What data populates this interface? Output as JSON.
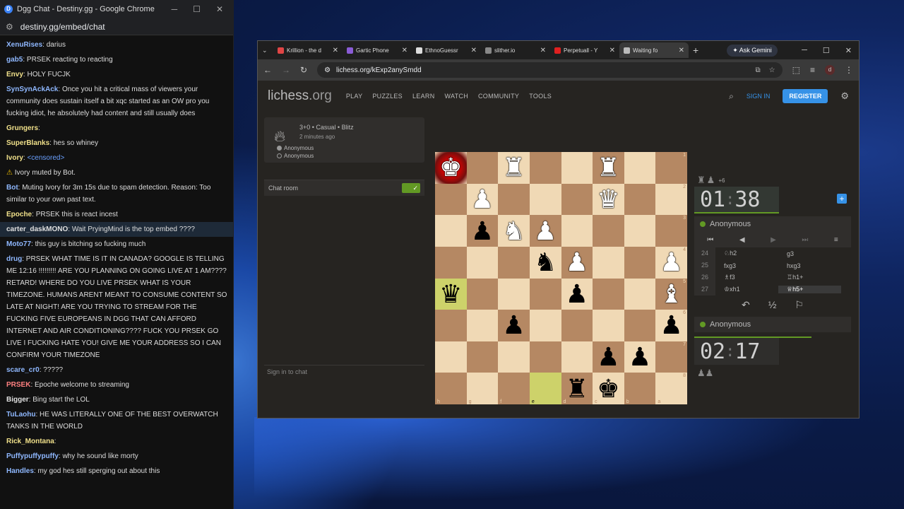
{
  "chat_window": {
    "title": "Dgg Chat - Destiny.gg - Google Chrome",
    "app_letter": "D",
    "url": "destiny.gg/embed/chat"
  },
  "chat": {
    "messages": [
      {
        "user": "XenuRises",
        "sep": ": ",
        "text": "darius",
        "user_color": "#8fb8ff"
      },
      {
        "user": "gab5",
        "sep": ": ",
        "text": "PRSEK reacting to reacting",
        "user_color": "#8fb8ff"
      },
      {
        "user": "Envy",
        "sep": ": ",
        "text": "HOLY FUCJK",
        "user_color": "#f0e08a"
      },
      {
        "user": "SynSynAckAck",
        "sep": ": ",
        "text": "Once you hit a critical mass of viewers your community does sustain itself a bit      xqc started as an OW pro you fucking idiot, he absolutely had content and still usually does",
        "user_color": "#8fb8ff"
      },
      {
        "user": "Grungers",
        "sep": ": ",
        "text": "",
        "user_color": "#f0e08a"
      },
      {
        "user": "SuperBlanks",
        "sep": ": ",
        "text": "hes so whiney",
        "user_color": "#f0e08a"
      },
      {
        "user": "Ivory",
        "sep": ": ",
        "text": "<censored>",
        "user_color": "#f0e08a"
      },
      {
        "user": "",
        "sep": "",
        "text": "Ivory muted by Bot.",
        "user_color": "#f0e08a"
      },
      {
        "user": "Bot",
        "sep": ": ",
        "text": "Muting Ivory for 3m 15s due to spam detection. Reason: Too similar to your own past text.",
        "user_color": "#8fb8ff"
      },
      {
        "user": "Epoche",
        "sep": ": ",
        "text": "PRSEK this is react incest",
        "user_color": "#f0e08a"
      },
      {
        "user": "carter_daskMONO",
        "sep": ": ",
        "text": "Wait PryingMind is the top embed          ????",
        "user_color": "#e0e0e0"
      },
      {
        "user": "Moto77",
        "sep": ": ",
        "text": "this guy is bitching so fucking much",
        "user_color": "#8fb8ff"
      },
      {
        "user": "drug",
        "sep": ": ",
        "text": "PRSEK WHAT TIME IS IT IN CANADA? GOOGLE IS TELLING ME 12:16 !!!!!!!!! ARE YOU PLANNING ON GOING LIVE AT 1 AM???? RETARD! WHERE DO YOU LIVE PRSEK WHAT IS YOUR TIMEZONE. HUMANS ARENT MEANT TO CONSUME CONTENT SO LATE AT NIGHT! ARE YOU TRYING TO STREAM FOR THE FUCKING FIVE EUROPEANS IN DGG THAT CAN AFFORD INTERNET AND AIR CONDITIONING???? FUCK YOU PRSEK GO LIVE I FUCKING HATE YOU! GIVE ME YOUR ADDRESS SO I CAN CONFIRM YOUR TIMEZONE",
        "user_color": "#8fb8ff"
      },
      {
        "user": "scare_cr0",
        "sep": ": ",
        "text": "?????",
        "user_color": "#8fb8ff"
      },
      {
        "user": "PRSEK",
        "sep": ": ",
        "text": "Epoche       welcome to streaming",
        "user_color": "#ff8080"
      },
      {
        "user": "Bigger",
        "sep": ": ",
        "text": "Bing start the LOL",
        "user_color": "#e0e0e0"
      },
      {
        "user": "TuLaohu",
        "sep": ": ",
        "text": "HE WAS LITERALLY ONE OF THE BEST OVERWATCH TANKS IN THE WORLD",
        "user_color": "#8fb8ff"
      },
      {
        "user": "Rick_Montana",
        "sep": ": ",
        "text": "",
        "user_color": "#f0e08a"
      },
      {
        "user": "Puffypuffypuffy",
        "sep": ": ",
        "text": "why he sound like morty",
        "user_color": "#8fb8ff"
      },
      {
        "user": "Handles",
        "sep": ": ",
        "text": "my god hes still sperging out about this",
        "user_color": "#8fb8ff"
      }
    ]
  },
  "browser": {
    "tabs": [
      {
        "label": "Krillion - the d",
        "color": "#e04545"
      },
      {
        "label": "Gartic Phone",
        "color": "#8a5cd6"
      },
      {
        "label": "EthnoGuessr",
        "color": "#dddddd"
      },
      {
        "label": "slither.io",
        "color": "#888888"
      },
      {
        "label": "Perpetuall - Y",
        "color": "#e02020"
      },
      {
        "label": "Waiting fo",
        "color": "#bbbbbb"
      }
    ],
    "new_tab": "+",
    "ask_gemini": "Ask Gemini",
    "url": "lichess.org/kExp2anySmdd",
    "profile_letter": "d"
  },
  "lichess": {
    "logo": "lichess",
    "logo_tld": ".org",
    "nav": [
      "PLAY",
      "PUZZLES",
      "LEARN",
      "WATCH",
      "COMMUNITY",
      "TOOLS"
    ],
    "sign_in": "SIGN IN",
    "register": "REGISTER",
    "game": {
      "mode": "3+0 • Casual • Blitz",
      "time_ago": "2 minutes ago",
      "player1": "Anonymous",
      "player2": "Anonymous"
    },
    "chat_room": "Chat room",
    "sign_in_chat": "Sign in to chat",
    "top_player": "Anonymous",
    "bottom_player": "Anonymous",
    "top_clock": {
      "min": "01",
      "sep": ":",
      "sec": "38"
    },
    "bottom_clock": {
      "min": "02",
      "sep": ":",
      "sec": "17"
    },
    "material_adv": "+6",
    "draw_label": "½",
    "moves": [
      {
        "n": "24",
        "w": "♘h2",
        "b": "g3"
      },
      {
        "n": "25",
        "w": "fxg3",
        "b": "hxg3"
      },
      {
        "n": "26",
        "w": "♗f3",
        "b": "♖h1+"
      },
      {
        "n": "27",
        "w": "♔xh1",
        "b": "♕h5+"
      }
    ]
  },
  "board": {
    "files": [
      "h",
      "g",
      "f",
      "e",
      "d",
      "c",
      "b",
      "a"
    ],
    "ranks": [
      "1",
      "2",
      "3",
      "4",
      "5",
      "6",
      "7",
      "8"
    ],
    "rows": [
      [
        "K",
        "",
        "R",
        "",
        "",
        "R",
        "",
        ""
      ],
      [
        "",
        "P",
        "",
        "",
        "",
        "Q",
        "",
        ""
      ],
      [
        "",
        "p",
        "N",
        "P",
        "",
        "",
        "",
        ""
      ],
      [
        "",
        "",
        "",
        "n",
        "P",
        "",
        "",
        "P"
      ],
      [
        "q",
        "",
        "",
        "",
        "p",
        "",
        "",
        "B"
      ],
      [
        "",
        "",
        "p",
        "",
        "",
        "",
        "",
        "p"
      ],
      [
        "",
        "",
        "",
        "",
        "",
        "p",
        "p",
        ""
      ],
      [
        "",
        "",
        "",
        "",
        "r",
        "k",
        "",
        ""
      ]
    ],
    "check_square": "h1",
    "highlight_squares": [
      "h5",
      "e8"
    ]
  }
}
